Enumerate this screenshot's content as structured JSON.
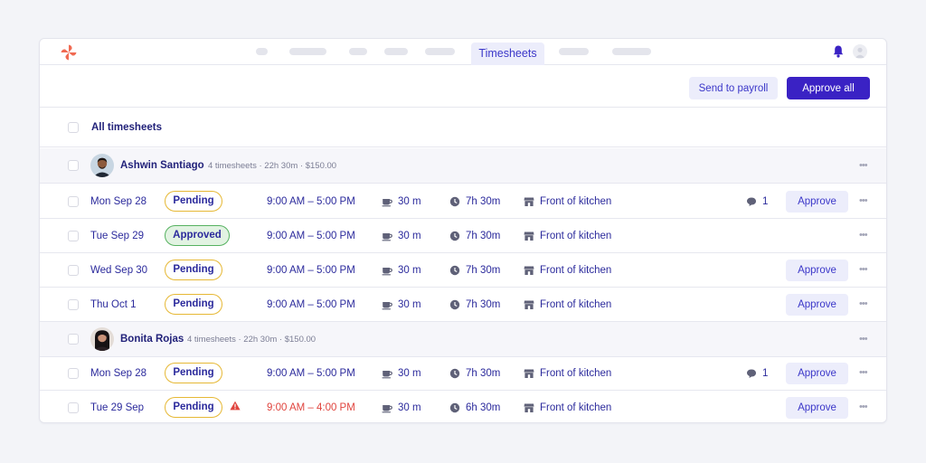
{
  "nav": {
    "active_tab": "Timesheets"
  },
  "actions": {
    "send_to_payroll": "Send to payroll",
    "approve_all": "Approve all"
  },
  "list": {
    "all_label": "All timesheets"
  },
  "groups": [
    {
      "name": "Ashwin Santiago",
      "meta": "4 timesheets · 22h 30m · $150.00",
      "rows": [
        {
          "date": "Mon Sep 28",
          "status": "Pending",
          "time": "9:00 AM – 5:00 PM",
          "break": "30 m",
          "duration": "7h 30m",
          "location": "Front of kitchen",
          "comments": "1",
          "action": "Approve"
        },
        {
          "date": "Tue Sep 29",
          "status": "Approved",
          "time": "9:00 AM – 5:00 PM",
          "break": "30 m",
          "duration": "7h 30m",
          "location": "Front of kitchen"
        },
        {
          "date": "Wed Sep 30",
          "status": "Pending",
          "time": "9:00 AM – 5:00 PM",
          "break": "30 m",
          "duration": "7h 30m",
          "location": "Front of kitchen",
          "action": "Approve"
        },
        {
          "date": "Thu Oct 1",
          "status": "Pending",
          "time": "9:00 AM – 5:00 PM",
          "break": "30 m",
          "duration": "7h 30m",
          "location": "Front of kitchen",
          "action": "Approve"
        }
      ]
    },
    {
      "name": "Bonita Rojas",
      "meta": "4 timesheets · 22h 30m · $150.00",
      "rows": [
        {
          "date": "Mon Sep 28",
          "status": "Pending",
          "time": "9:00 AM – 5:00 PM",
          "break": "30 m",
          "duration": "7h 30m",
          "location": "Front of kitchen",
          "comments": "1",
          "action": "Approve"
        },
        {
          "date": "Tue 29 Sep",
          "status": "Pending",
          "time": "9:00 AM – 4:00 PM",
          "break": "30 m",
          "duration": "6h 30m",
          "location": "Front of kitchen",
          "action": "Approve",
          "warning": true
        }
      ]
    }
  ],
  "colors": {
    "primary": "#3a22c4",
    "pending_border": "#e6b835",
    "approved_border": "#56b260",
    "approved_bg": "#e2f3e2",
    "warning": "#e0443e",
    "logo": "#f06a52"
  }
}
